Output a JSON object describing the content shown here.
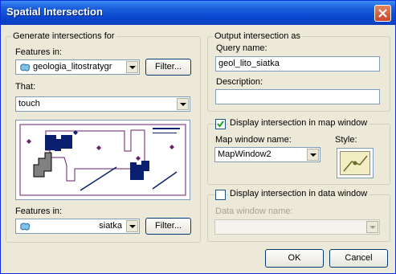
{
  "window": {
    "title": "Spatial Intersection"
  },
  "left": {
    "group_title": "Generate intersections for",
    "features_in_label": "Features in:",
    "features_in_value": "geologia_litostratygr",
    "filter_label": "Filter...",
    "that_label": "That:",
    "that_value": "touch",
    "features_in2_label": "Features in:",
    "features_in2_value": "siatka",
    "filter2_label": "Filter..."
  },
  "output": {
    "group_title": "Output intersection as",
    "query_name_label": "Query name:",
    "query_name_value": "geol_lito_siatka",
    "description_label": "Description:",
    "description_value": ""
  },
  "map_window": {
    "checkbox_label": "Display intersection in map window",
    "checked": true,
    "name_label": "Map window name:",
    "name_value": "MapWindow2",
    "style_label": "Style:"
  },
  "data_window": {
    "checkbox_label": "Display intersection in data window",
    "checked": false,
    "name_label": "Data window name:",
    "name_value": ""
  },
  "buttons": {
    "ok": "OK",
    "cancel": "Cancel"
  },
  "colors": {
    "titlebar": "#0a46d0",
    "map_border": "#6b1e6b",
    "shape_fill": "#0a1f6e",
    "gray_shape": "#808080"
  }
}
